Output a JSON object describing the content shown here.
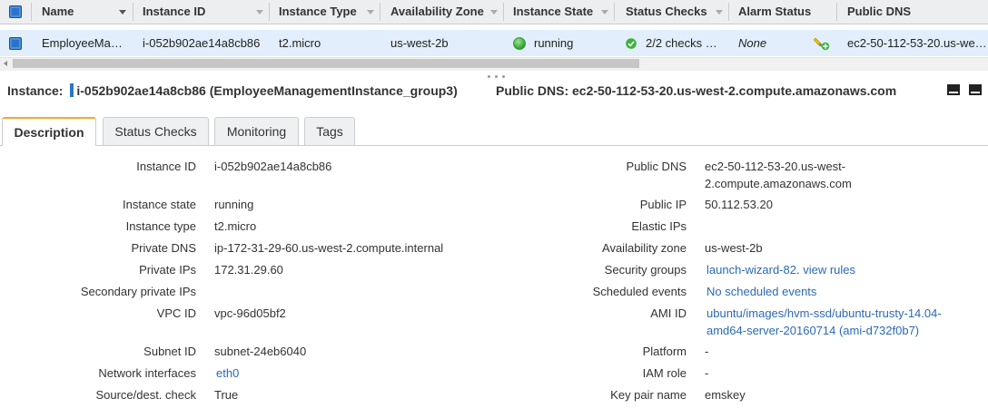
{
  "table": {
    "headers": {
      "name": "Name",
      "instance_id": "Instance ID",
      "instance_type": "Instance Type",
      "availability_zone": "Availability Zone",
      "instance_state": "Instance State",
      "status_checks": "Status Checks",
      "alarm_status": "Alarm Status",
      "public_dns": "Public DNS"
    },
    "row": {
      "name": "EmployeeMa…",
      "instance_id": "i-052b902ae14a8cb86",
      "instance_type": "t2.micro",
      "availability_zone": "us-west-2b",
      "instance_state": "running",
      "status_checks": "2/2 checks …",
      "alarm_status": "None",
      "public_dns": "ec2-50-112-53-20.us-we…"
    }
  },
  "summary": {
    "instance_label": "Instance:",
    "instance_value": "i-052b902ae14a8cb86 (EmployeeManagementInstance_group3)",
    "dns_label": "Public DNS:",
    "dns_value": "ec2-50-112-53-20.us-west-2.compute.amazonaws.com"
  },
  "tabs": [
    "Description",
    "Status Checks",
    "Monitoring",
    "Tags"
  ],
  "details": {
    "left": [
      {
        "label": "Instance ID",
        "value": "i-052b902ae14a8cb86"
      },
      {
        "label": "Instance state",
        "value": "running"
      },
      {
        "label": "Instance type",
        "value": "t2.micro"
      },
      {
        "label": "Private DNS",
        "value": "ip-172-31-29-60.us-west-2.compute.internal"
      },
      {
        "label": "Private IPs",
        "value": "172.31.29.60"
      },
      {
        "label": "Secondary private IPs",
        "value": ""
      },
      {
        "label": "VPC ID",
        "value": "vpc-96d05bf2"
      },
      {
        "label": "Subnet ID",
        "value": "subnet-24eb6040"
      },
      {
        "label": "Network interfaces",
        "value": "eth0"
      },
      {
        "label": "Source/dest. check",
        "value": "True"
      }
    ],
    "right": [
      {
        "label": "Public DNS",
        "value_line1": "ec2-50-112-53-20.us-west-",
        "value_line2": "2.compute.amazonaws.com"
      },
      {
        "label": "Public IP",
        "value": "50.112.53.20"
      },
      {
        "label": "Elastic IPs",
        "value": ""
      },
      {
        "label": "Availability zone",
        "value": "us-west-2b"
      },
      {
        "label": "Security groups",
        "value": "launch-wizard-82",
        "extra": "view rules"
      },
      {
        "label": "Scheduled events",
        "value": "No scheduled events"
      },
      {
        "label": "AMI ID",
        "value_line1": "ubuntu/images/hvm-ssd/ubuntu-trusty-14.04-",
        "value_line2": "amd64-server-20160714 (ami-d732f0b7)"
      },
      {
        "label": "Platform",
        "value": "-"
      },
      {
        "label": "IAM role",
        "value": "-"
      },
      {
        "label": "Key pair name",
        "value": "emskey"
      }
    ]
  },
  "colors": {
    "selected_row": "#e2eefb",
    "link": "#2a6ab8",
    "tab_active_accent": "#f0a830",
    "running_green": "#3cb33c",
    "header_bg": "#eceef0"
  },
  "icons": [
    "checkbox-icon",
    "running-status-icon",
    "checks-passed-icon",
    "add-alarm-icon",
    "maximize-panel-icon",
    "restore-panel-icon"
  ]
}
